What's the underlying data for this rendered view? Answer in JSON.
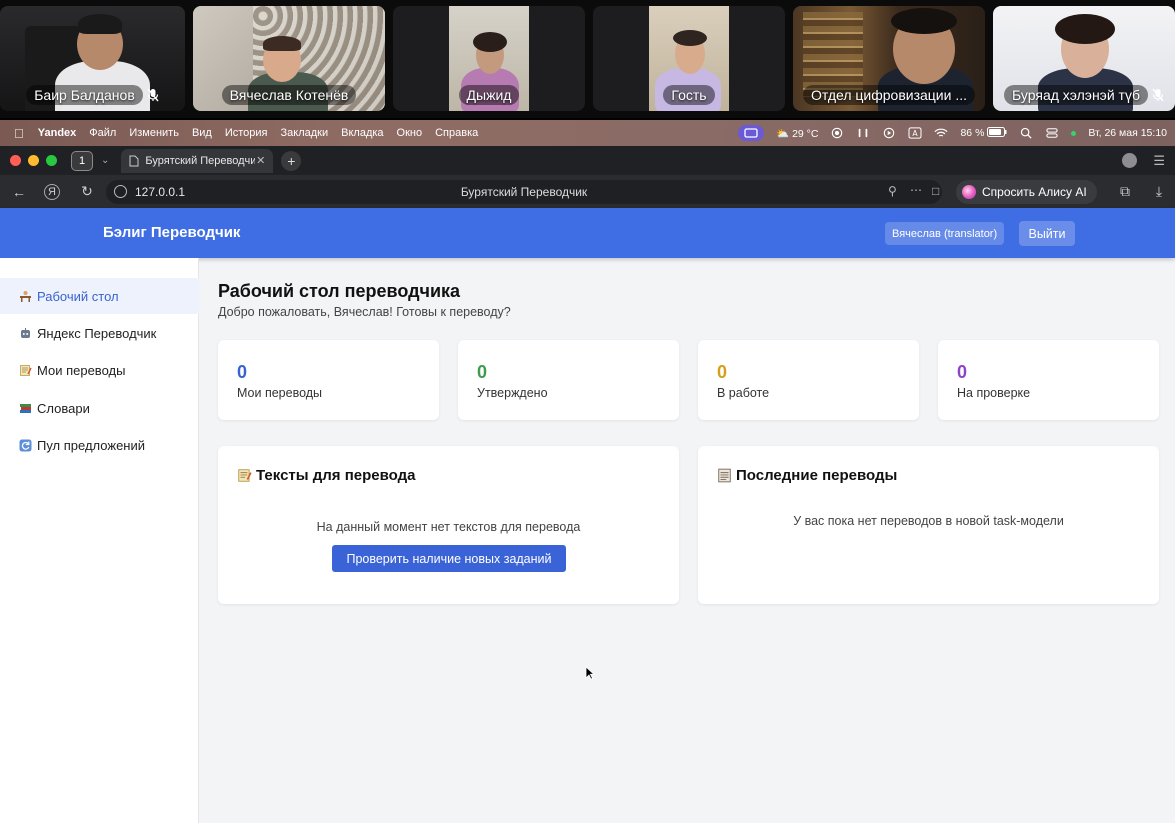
{
  "call": {
    "participants": [
      {
        "name": "Баир Балданов",
        "muted": true
      },
      {
        "name": "Вячеслав Котенёв",
        "muted": false
      },
      {
        "name": "Дыжид",
        "muted": false
      },
      {
        "name": "Гость",
        "muted": false
      },
      {
        "name": "Отдел цифровизации ...",
        "muted": false
      },
      {
        "name": "Буряад хэлэнэй түб",
        "muted": true
      }
    ]
  },
  "menubar": {
    "app": "Yandex",
    "items": [
      "Файл",
      "Изменить",
      "Вид",
      "История",
      "Закладки",
      "Вкладка",
      "Окно",
      "Справка"
    ],
    "weather": "29 °C",
    "battery": "86 %",
    "datetime": "Вт, 26 мая  15:10"
  },
  "browser": {
    "tab_count": "1",
    "tab_title": "Бурятский Переводчик",
    "url": "127.0.0.1",
    "page_title": "Бурятский Переводчик",
    "alisa_label": "Спросить Алису AI"
  },
  "app": {
    "brand": "Бэлиг Переводчик",
    "user_label": "Вячеслав (translator)",
    "logout_label": "Выйти",
    "sidebar": [
      {
        "label": "Рабочий стол",
        "icon": "desk-icon",
        "active": true
      },
      {
        "label": "Яндекс Переводчик",
        "icon": "robot-icon",
        "active": false
      },
      {
        "label": "Мои переводы",
        "icon": "memo-icon",
        "active": false
      },
      {
        "label": "Словари",
        "icon": "books-icon",
        "active": false
      },
      {
        "label": "Пул предложений",
        "icon": "refresh-icon",
        "active": false
      }
    ],
    "title": "Рабочий стол переводчика",
    "subtitle": "Добро пожаловать, Вячеслав! Готовы к переводу?",
    "stats": [
      {
        "value": "0",
        "label": "Мои переводы",
        "color": "#3a63d1"
      },
      {
        "value": "0",
        "label": "Утверждено",
        "color": "#3e9c4e"
      },
      {
        "value": "0",
        "label": "В работе",
        "color": "#d4a01c"
      },
      {
        "value": "0",
        "label": "На проверке",
        "color": "#8e44c9"
      }
    ],
    "texts_panel": {
      "title": "Тексты для перевода",
      "empty": "На данный момент нет текстов для перевода",
      "button": "Проверить наличие новых заданий"
    },
    "recent_panel": {
      "title": "Последние переводы",
      "empty": "У вас пока нет переводов в новой task-модели"
    }
  }
}
